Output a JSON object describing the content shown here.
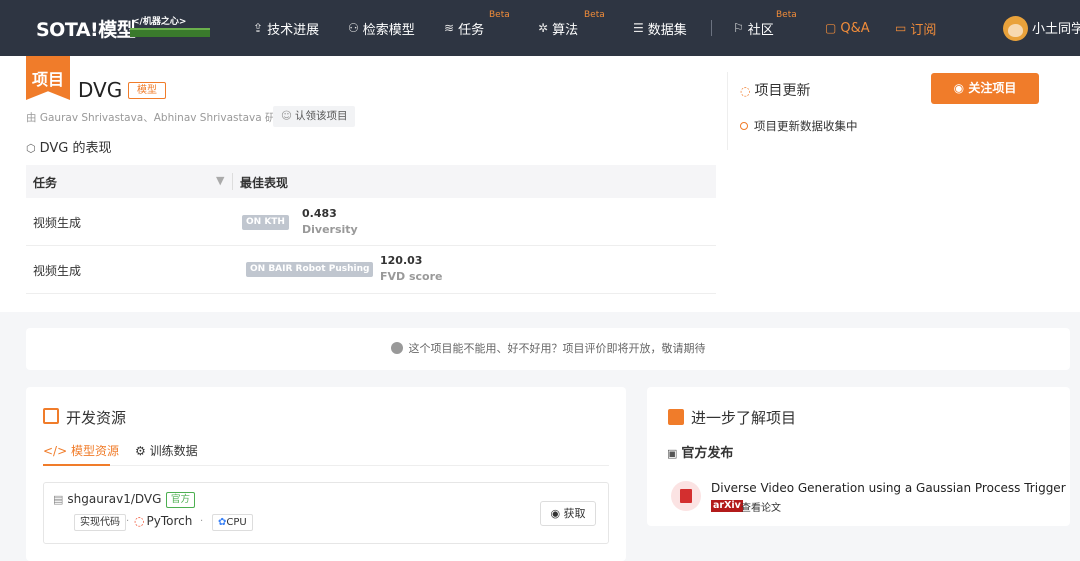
{
  "nav": {
    "logo_text": "SOTA!模型",
    "logo_sub": "</机器之心>",
    "items": [
      {
        "label": "技术进展",
        "icon": "rocket-icon",
        "beta": ""
      },
      {
        "label": "检索模型",
        "icon": "nodes-icon",
        "beta": ""
      },
      {
        "label": "任务",
        "icon": "layers-icon",
        "beta": "Beta"
      },
      {
        "label": "算法",
        "icon": "algorithm-icon",
        "beta": "Beta"
      },
      {
        "label": "数据集",
        "icon": "database-icon",
        "beta": ""
      },
      {
        "label": "社区",
        "icon": "flag-icon",
        "beta": "Beta"
      },
      {
        "label": "Q&A",
        "icon": "qa-icon",
        "beta": ""
      },
      {
        "label": "订阅",
        "icon": "bookmark-icon",
        "beta": ""
      }
    ],
    "user_name": "小土同学"
  },
  "project": {
    "ribbon": "项目",
    "name": "DVG",
    "type_tag": "模型",
    "authors": "由 Gaurav Shrivastava、Abhinav Shrivastava 研发",
    "claim_label": "认领该项目",
    "performance_title": "DVG 的表现"
  },
  "table": {
    "headers": {
      "task": "任务",
      "best": "最佳表现"
    },
    "rows": [
      {
        "task": "视频生成",
        "dataset": "ON KTH",
        "value": "0.483",
        "metric": "Diversity"
      },
      {
        "task": "视频生成",
        "dataset": "ON BAIR Robot Pushing",
        "value": "120.03",
        "metric": "FVD score"
      }
    ]
  },
  "updates": {
    "title": "项目更新",
    "follow_label": "关注项目",
    "item": "项目更新数据收集中"
  },
  "feedback": {
    "text": "这个项目能不能用、好不好用？项目评价即将开放，敬请期待"
  },
  "dev": {
    "title": "开发资源",
    "tabs": [
      "模型资源",
      "训练数据"
    ],
    "repo": {
      "name": "shgaurav1/DVG",
      "official_tag": "官方",
      "impl_tag": "实现代码",
      "framework": "PyTorch",
      "device": "CPU",
      "get_label": "获取"
    }
  },
  "learn": {
    "title": "进一步了解项目",
    "official_title": "官方发布",
    "paper_title": "Diverse Video Generation using a Gaussian Process Trigger",
    "arxiv_label": "arXiv",
    "view_paper": "查看论文"
  },
  "colors": {
    "accent": "#f07c2a",
    "nav_bg": "#2e3542",
    "official_green": "#4caf50",
    "arxiv_red": "#b31b1b"
  }
}
